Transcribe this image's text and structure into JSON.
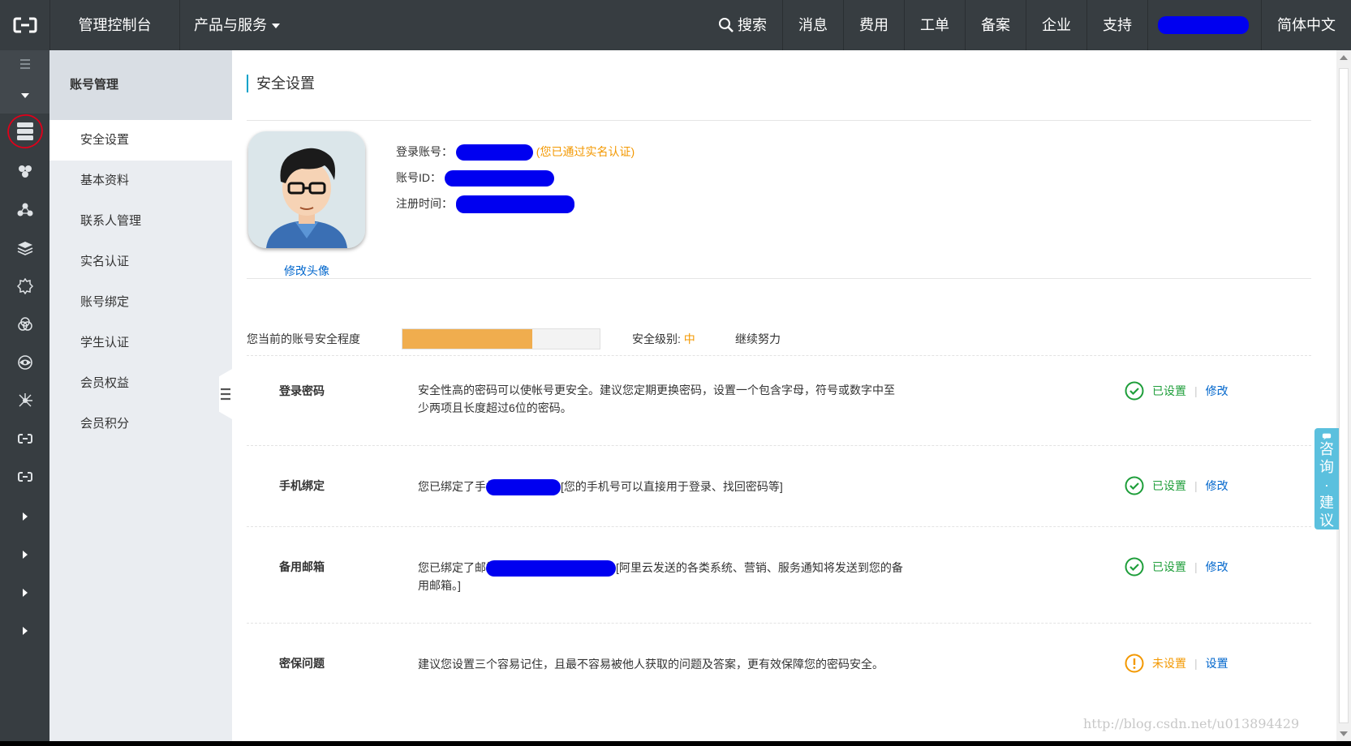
{
  "header": {
    "logo_icon": "aliyun-logo-icon",
    "console_title": "管理控制台",
    "products_label": "产品与服务",
    "search_label": "搜索",
    "nav": [
      "消息",
      "费用",
      "工单",
      "备案",
      "企业",
      "支持"
    ],
    "language": "简体中文"
  },
  "iconbar": {
    "items": [
      "menu-icon",
      "dropdown-icon",
      "server-list-icon",
      "cluster-icon",
      "network-icon",
      "layers-icon",
      "gear-chip-icon",
      "cloud-icon",
      "eye-icon",
      "hub-icon",
      "aliyun-link-icon",
      "aliyun-link-icon",
      "chevron-right-icon",
      "chevron-right-icon",
      "chevron-right-icon",
      "chevron-right-icon"
    ]
  },
  "sidebar": {
    "title": "账号管理",
    "items": [
      "安全设置",
      "基本资料",
      "联系人管理",
      "实名认证",
      "账号绑定",
      "学生认证",
      "会员权益",
      "会员积分"
    ],
    "active": "安全设置"
  },
  "main": {
    "title": "安全设置",
    "edit_avatar": "修改头像",
    "login_account_label": "登录账号：",
    "verified_text": "(您已通过实名认证)",
    "account_id_label": "账号ID：",
    "register_time_label": "注册时间：",
    "level_label": "您当前的账号安全程度",
    "level_progress": 0.66,
    "level_prefix": "安全级别: ",
    "level_value": "中",
    "level_hint": "继续努力",
    "rows": [
      {
        "name": "登录密码",
        "desc": "安全性高的密码可以使帐号更安全。建议您定期更换密码，设置一个包含字母，符号或数字中至少两项且长度超过6位的密码。",
        "status": "已设置",
        "action": "修改",
        "status_type": "ok"
      },
      {
        "name": "手机绑定",
        "desc_a": "您已绑定了手机",
        "desc_b": "[您的手机号可以直接用于登录、找回密码等]",
        "status": "已设置",
        "action": "修改",
        "status_type": "ok"
      },
      {
        "name": "备用邮箱",
        "desc_a": "您已绑定了邮箱",
        "desc_b": "[阿里云发送的各类系统、营销、服务通知将发送到您的备用邮箱。]",
        "status": "已设置",
        "action": "修改",
        "status_type": "ok"
      },
      {
        "name": "密保问题",
        "desc": "建议您设置三个容易记住，且最不容易被他人获取的问题及答案，更有效保障您的密码安全。",
        "status": "未设置",
        "action": "设置",
        "status_type": "warn"
      }
    ]
  },
  "consult": {
    "text": "咨询·建议"
  },
  "watermark": "http://blog.csdn.net/u013894429",
  "colors": {
    "topbar": "#373d41",
    "sidebar": "#eaedf1",
    "link": "#0066cc",
    "ok": "#1e9e3a",
    "warn": "#f39800",
    "progress": "#f0ad4e",
    "redaction": "#0000f0"
  }
}
